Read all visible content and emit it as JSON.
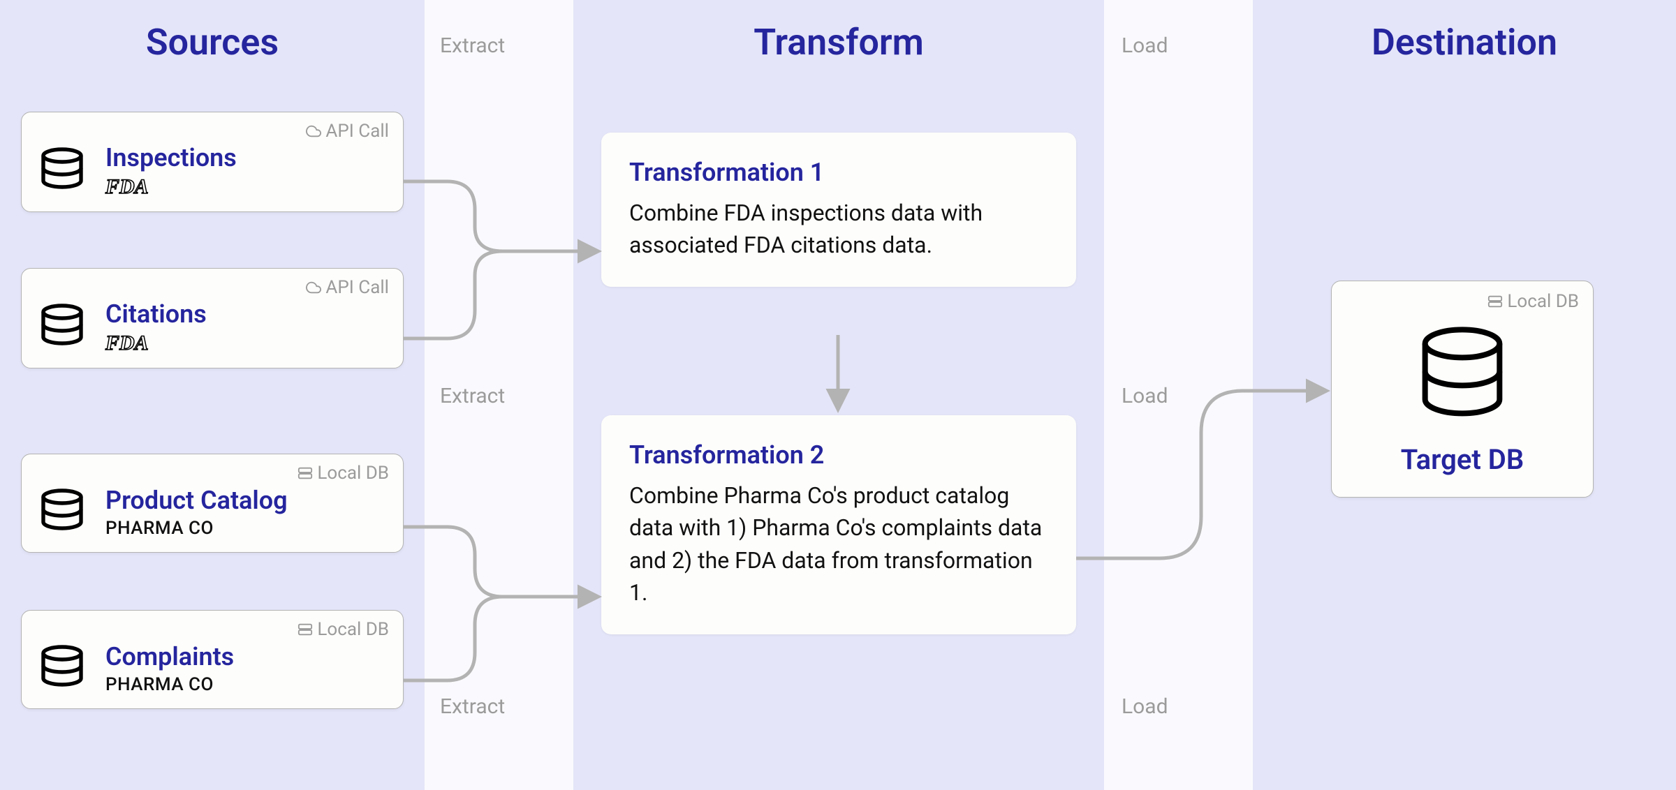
{
  "columns": {
    "sources": "Sources",
    "transform": "Transform",
    "destination": "Destination"
  },
  "gap_labels": {
    "extract": "Extract",
    "load": "Load"
  },
  "badges": {
    "api_call": "API Call",
    "local_db": "Local DB"
  },
  "sources": [
    {
      "title": "Inspections",
      "sub": "FDA",
      "badge_key": "api_call"
    },
    {
      "title": "Citations",
      "sub": "FDA",
      "badge_key": "api_call"
    },
    {
      "title": "Product Catalog",
      "sub": "PHARMA CO",
      "badge_key": "local_db"
    },
    {
      "title": "Complaints",
      "sub": "PHARMA CO",
      "badge_key": "local_db"
    }
  ],
  "transforms": [
    {
      "title": "Transformation 1",
      "desc": "Combine FDA inspections data with associated FDA citations data."
    },
    {
      "title": "Transformation 2",
      "desc": "Combine Pharma Co's product catalog data with 1) Pharma Co's complaints data and 2) the FDA data from transformation 1."
    }
  ],
  "destination": {
    "title": "Target DB",
    "badge_key": "local_db"
  }
}
